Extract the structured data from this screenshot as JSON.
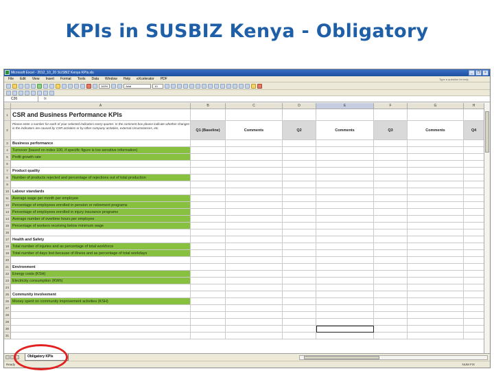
{
  "slide": {
    "title": "KPIs in SUSBIZ Kenya - Obligatory"
  },
  "window": {
    "title": "Microsoft Excel - 2012_10_20 SUSBIZ Kenya KPIs.xls"
  },
  "menu": [
    "File",
    "Edit",
    "View",
    "Insert",
    "Format",
    "Tools",
    "Data",
    "Window",
    "Help",
    "eXcelerator",
    "PDF"
  ],
  "help_box": "Type a question for help",
  "toolbar": {
    "zoom": "100%",
    "font": "Arial",
    "size": "10"
  },
  "formula_bar": {
    "cell_ref": "C26",
    "fx": "fx",
    "value": ""
  },
  "columns": [
    "A",
    "B",
    "C",
    "D",
    "E",
    "F",
    "G",
    "H"
  ],
  "rows": [
    {
      "n": "1",
      "a": "CSR and Business Performance KPIs",
      "type": "title"
    },
    {
      "n": "2",
      "a": "Please enter a number for each of your selected indicators every quarter. In the comment box please indicate whether changes in the indicators are caused by CSR activities or by other company activities, external circumstances, etc.",
      "type": "instr"
    },
    {
      "n": "3",
      "a": "Business performance",
      "type": "section"
    },
    {
      "n": "4",
      "a": "Turnover (based on index 100, if specific figure is too sensitive information)",
      "type": "green"
    },
    {
      "n": "5",
      "a": "Profit growth rate",
      "type": "green"
    },
    {
      "n": "6",
      "a": "",
      "type": "blank"
    },
    {
      "n": "7",
      "a": "Product quality",
      "type": "section"
    },
    {
      "n": "8",
      "a": "Number of products rejected and percentage of rejections out of total production",
      "type": "green"
    },
    {
      "n": "9",
      "a": "",
      "type": "blank"
    },
    {
      "n": "10",
      "a": "Labour standards",
      "type": "section"
    },
    {
      "n": "11",
      "a": "Average wage per month per employee",
      "type": "green"
    },
    {
      "n": "12",
      "a": "Percentage of employees enrolled in pension or retirement programs",
      "type": "green"
    },
    {
      "n": "13",
      "a": "Percentage of employees enrolled in injury insurance programs",
      "type": "green"
    },
    {
      "n": "14",
      "a": "Average number of overtime hours per employee",
      "type": "green"
    },
    {
      "n": "15",
      "a": "Percentage of workers receiving below minimum wage",
      "type": "green"
    },
    {
      "n": "16",
      "a": "",
      "type": "blank"
    },
    {
      "n": "17",
      "a": "Health and Safety",
      "type": "section"
    },
    {
      "n": "18",
      "a": "Total number of injuries and as percentage of total workforce",
      "type": "green"
    },
    {
      "n": "19",
      "a": "Total number of days lost because of illness and as percentage of total workdays",
      "type": "green"
    },
    {
      "n": "20",
      "a": "",
      "type": "blank"
    },
    {
      "n": "21",
      "a": "Environment",
      "type": "section"
    },
    {
      "n": "22",
      "a": "Energy costs (KSH)",
      "type": "green"
    },
    {
      "n": "23",
      "a": "Electricity consumption (KWh)",
      "type": "green"
    },
    {
      "n": "24",
      "a": "",
      "type": "blank"
    },
    {
      "n": "25",
      "a": "Community involvement",
      "type": "section"
    },
    {
      "n": "26",
      "a": "Money spent on community improvement activities (KSH)",
      "type": "green"
    },
    {
      "n": "27",
      "a": "",
      "type": "blank"
    },
    {
      "n": "28",
      "a": "",
      "type": "blank"
    },
    {
      "n": "29",
      "a": "",
      "type": "blank"
    },
    {
      "n": "30",
      "a": "",
      "type": "blank"
    },
    {
      "n": "31",
      "a": "",
      "type": "blank"
    }
  ],
  "header_row": [
    "Q1 (Baseline)",
    "Comments",
    "Q2",
    "Comments",
    "Q3",
    "Comments",
    "Q4"
  ],
  "sheet_tab": "Obligatory KPIs",
  "status": {
    "left": "Ready",
    "right": "NUM  FIX"
  }
}
